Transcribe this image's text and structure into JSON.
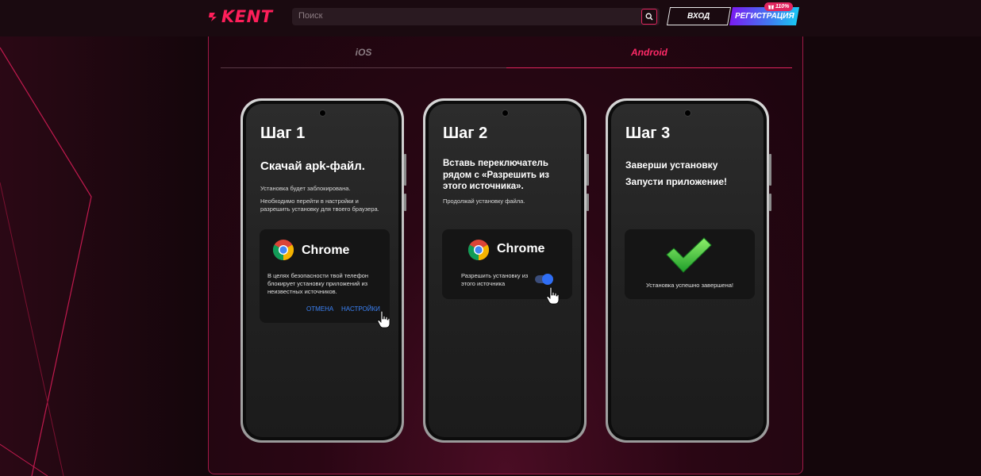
{
  "colors": {
    "accent": "#ff1f5a",
    "tab_active": "#ff2a68",
    "tab_inactive": "#8a7c82",
    "link": "#3b82f6",
    "register_gradient": [
      "#7a1cf2",
      "#3f7cf0",
      "#19c7f3"
    ],
    "checkmark": "#3fd13f"
  },
  "header": {
    "logo_text": "KENT",
    "search_placeholder": "Поиск",
    "search_icon": "search-icon",
    "login_label": "ВХОД",
    "register_label": "РЕГИСТРАЦИЯ",
    "bonus_badge": "110%",
    "bonus_icon": "gift-icon"
  },
  "tabs": [
    {
      "label": "iOS",
      "active": false
    },
    {
      "label": "Android",
      "active": true
    }
  ],
  "phones": [
    {
      "step": "Шаг 1",
      "headline": "Скачай apk-файл.",
      "notes": [
        "Установка будет заблокирована.",
        "Необходимо перейти в настройки и разрешить установку для твоего браузера."
      ],
      "card": {
        "app_name": "Chrome",
        "message": "В целях безопасности твой телефон блокирует установку приложений из неизвестных источников.",
        "cancel": "ОТМЕНА",
        "settings": "НАСТРОЙКИ"
      }
    },
    {
      "step": "Шаг 2",
      "headline": "Вставь переключатель рядом с «Разрешить из этого источника».",
      "notes": [
        "Продолжай установку файла."
      ],
      "card": {
        "app_name": "Chrome",
        "toggle_label": "Разрешить установку из этого источника",
        "toggle_on": true
      }
    },
    {
      "step": "Шаг 3",
      "headline": "Заверши установку",
      "headline2": "Запусти приложение!",
      "card": {
        "success_text": "Установка успешно завершена!"
      }
    }
  ]
}
